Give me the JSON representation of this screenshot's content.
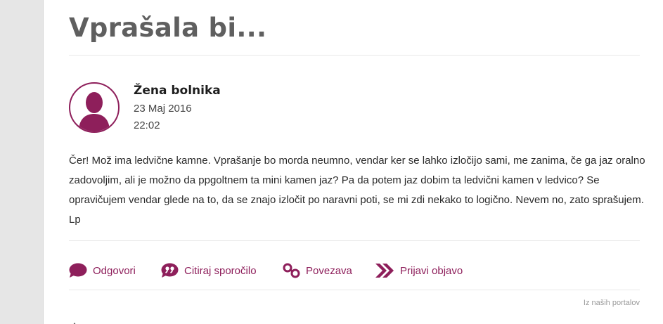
{
  "question": {
    "title": "Vprašala bi...",
    "author": "Žena bolnika",
    "date": "23 Maj 2016",
    "time": "22:02",
    "body": "Čer! Mož ima ledvične kamne. Vprašanje bo morda neumno, vendar ker se lahko izločijo sami, me zanima, če ga jaz oralno zadovoljim, ali je možno da ppgoltnem ta mini kamen jaz? Pa da potem jaz dobim ta ledvični kamen v ledvico? Se opravičujem vendar glede na to, da se znajo izločit po naravni poti, se mi zdi nekako to logično. Nevem no, zato sprašujem. Lp"
  },
  "actions": [
    {
      "label": "Odgovori",
      "icon": "speech-bubble-icon"
    },
    {
      "label": "Citiraj sporočilo",
      "icon": "quote-icon"
    },
    {
      "label": "Povezava",
      "icon": "link-icon"
    },
    {
      "label": "Prijavi objavo",
      "icon": "double-chevron-icon"
    }
  ],
  "source_note": "Iz naših portalov",
  "colors": {
    "accent": "#8e1f5b",
    "title": "#5f5f5f",
    "background": "#e6e6e6"
  }
}
